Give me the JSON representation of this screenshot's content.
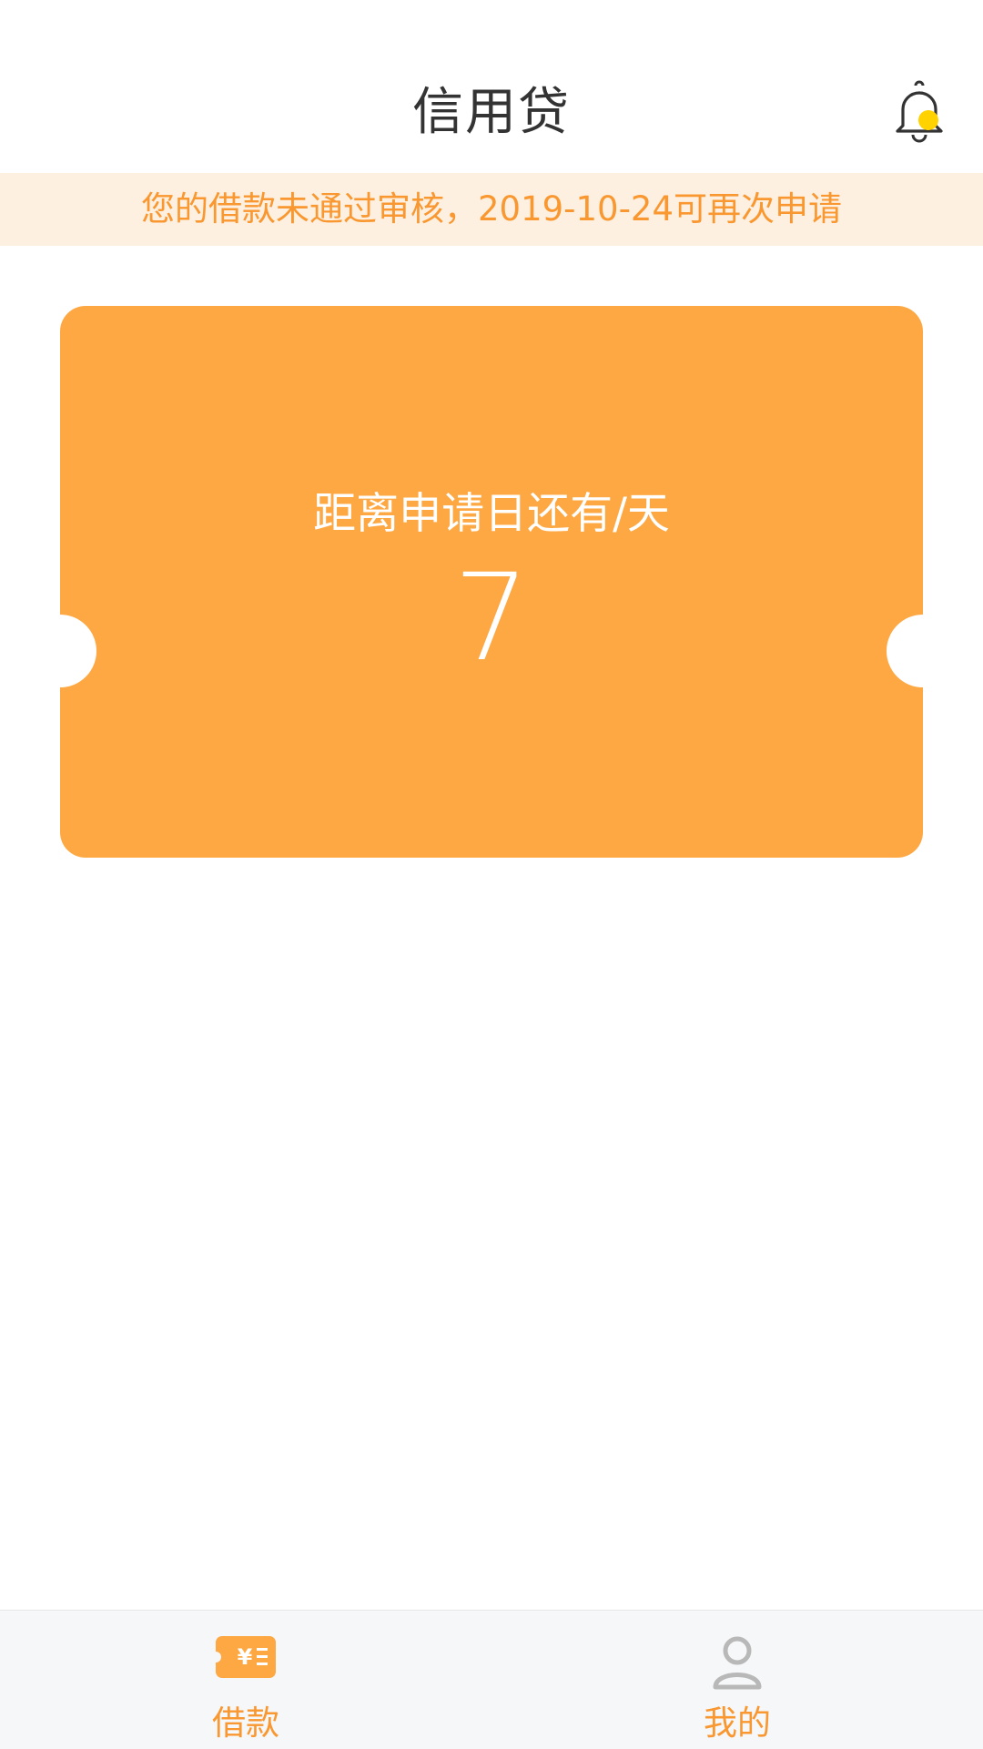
{
  "header": {
    "title": "信用贷",
    "bell_icon": "bell-icon",
    "bell_badge_color": "#ffd200"
  },
  "notice": {
    "text": "您的借款未通过审核，2019-10-24可再次申请",
    "text_color": "#f99730",
    "background": "#fef0e1"
  },
  "card": {
    "label": "距离申请日还有/天",
    "days": "7",
    "background": "#fda843"
  },
  "tabbar": {
    "tabs": [
      {
        "label": "借款",
        "icon": "loan-ticket-icon",
        "active": true
      },
      {
        "label": "我的",
        "icon": "user-icon",
        "active": false
      }
    ],
    "active_color": "#f99730",
    "inactive_icon_color": "#b8b8b8"
  }
}
